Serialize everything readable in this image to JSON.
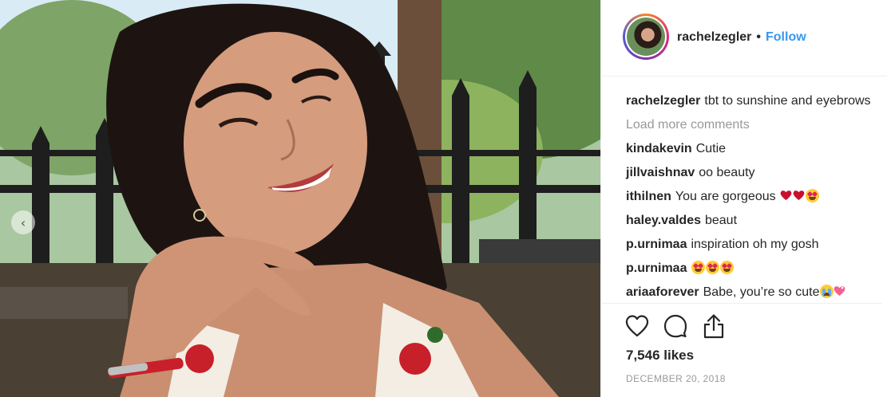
{
  "post": {
    "username": "rachelzegler",
    "separator": "•",
    "follow_label": "Follow",
    "photo_alt": "Selfie of a smiling woman with dark wavy hair in a park",
    "caption": {
      "user": "rachelzegler",
      "text": "tbt to sunshine and eyebrows"
    },
    "load_more_label": "Load more comments",
    "comments": [
      {
        "user": "kindakevin",
        "text": "Cutie"
      },
      {
        "user": "jillvaishnav",
        "text": "oo beauty"
      },
      {
        "user": "ithilnen",
        "text": "You are gorgeous"
      },
      {
        "user": "haley.valdes",
        "text": "beaut"
      },
      {
        "user": "p.urnimaa",
        "text": "inspiration oh my gosh"
      },
      {
        "user": "p.urnimaa",
        "text": ""
      },
      {
        "user": "ariaaforever",
        "text": "Babe, you’re so cute"
      }
    ],
    "likes": "7,546 likes",
    "date": "DECEMBER 20, 2018"
  },
  "icons": {
    "like": "heart-outline-icon",
    "comment": "comment-bubble-icon",
    "share": "share-upload-icon",
    "prev": "chevron-left-icon"
  },
  "colors": {
    "follow": "#3897f0",
    "muted": "#999999",
    "text": "#262626",
    "heart": "#e0245e"
  }
}
